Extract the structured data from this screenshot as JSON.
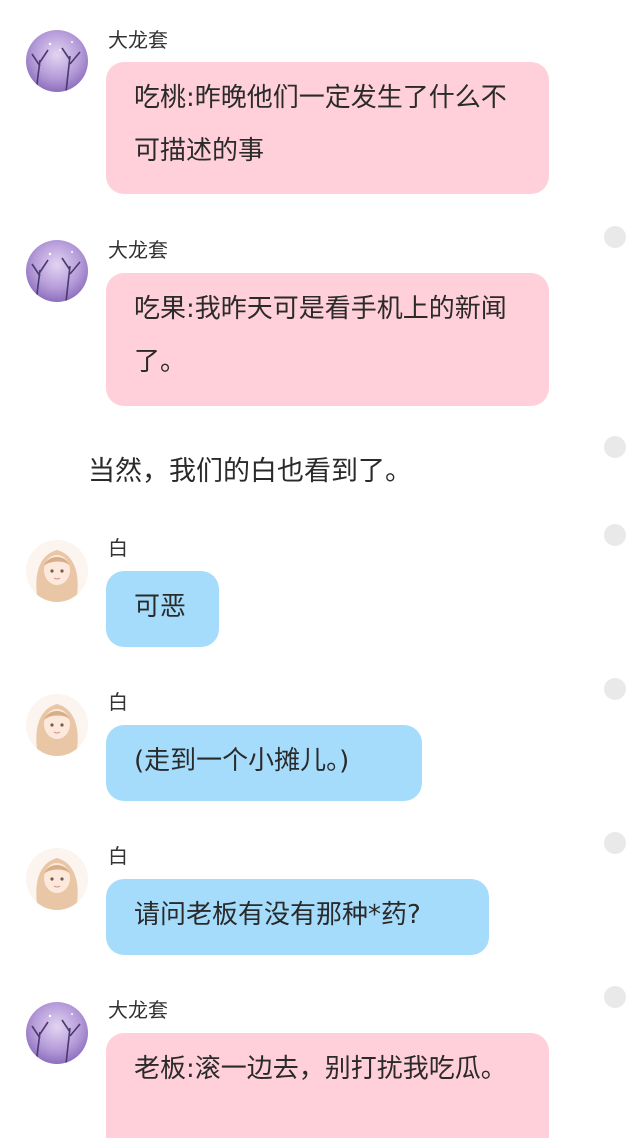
{
  "senders": {
    "dalongtao": "大龙套",
    "bai": "白"
  },
  "messages": {
    "m1": {
      "sender": "大龙套",
      "text": "吃桃:昨晚他们一定发生了什么不可描述的事"
    },
    "m2": {
      "sender": "大龙套",
      "text": "吃果:我昨天可是看手机上的新闻了。"
    },
    "narration": "当然，我们的白也看到了。",
    "m3": {
      "sender": "白",
      "text": "可恶"
    },
    "m4": {
      "sender": "白",
      "text": "(走到一个小摊儿。)"
    },
    "m5": {
      "sender": "白",
      "text": "请问老板有没有那种*药?"
    },
    "m6": {
      "sender": "大龙套",
      "text": "老板:滚一边去，别打扰我吃瓜。"
    }
  },
  "colors": {
    "pink_bubble": "#ffd0da",
    "blue_bubble": "#a6dcfb",
    "background": "#ffffff",
    "side_dot": "#e9e9e9"
  },
  "icons": {
    "dalongtao_avatar": "purple-night-tree-avatar",
    "bai_avatar": "anime-girl-avatar",
    "side_dot": "circle-dot-icon"
  }
}
